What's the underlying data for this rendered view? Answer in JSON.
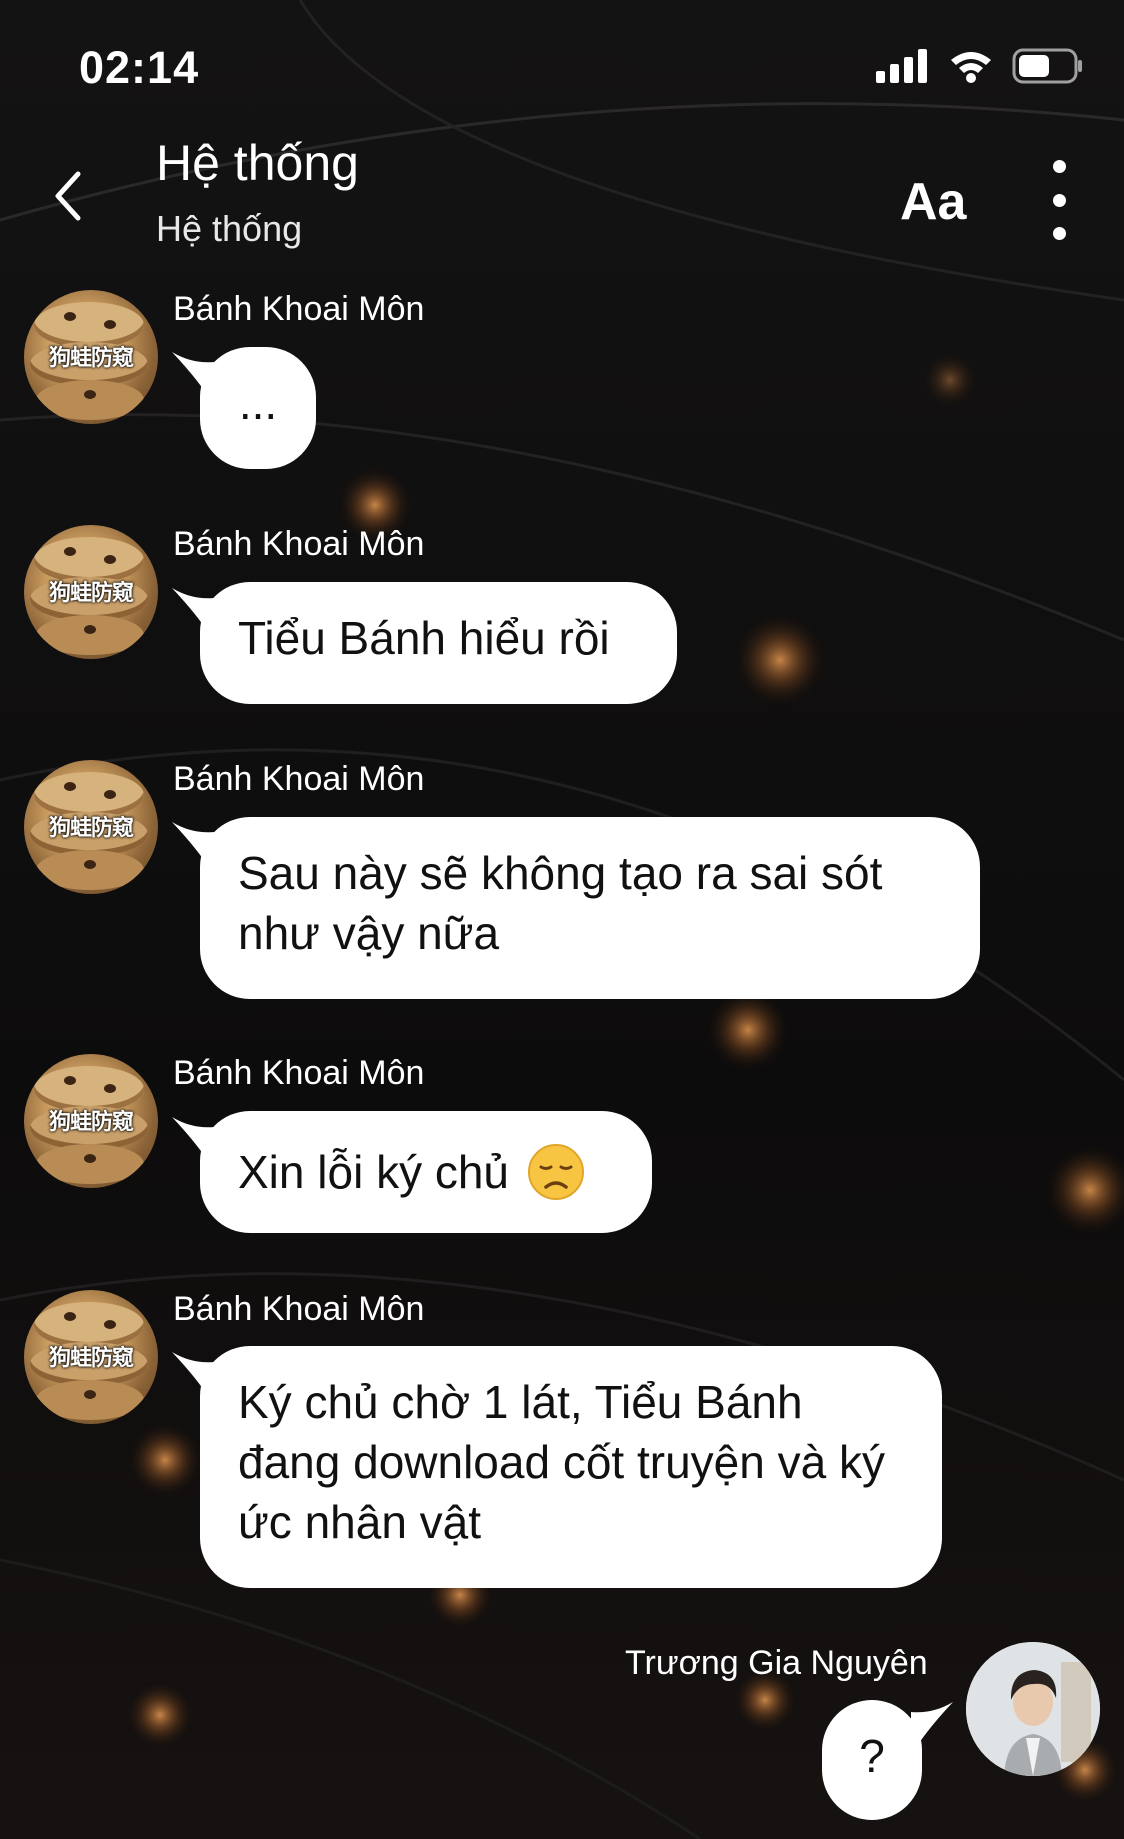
{
  "status_bar": {
    "time": "02:14",
    "icons": [
      "signal-icon",
      "wifi-icon",
      "battery-icon"
    ]
  },
  "header": {
    "back_icon": "chevron-left-icon",
    "title": "Hệ thống",
    "subtitle": "Hệ thống",
    "font_button": "Aa",
    "more_icon": "more-vertical-icon"
  },
  "avatar_watermark": "狗蛙防窥",
  "messages": [
    {
      "sender": "Bánh Khoai Môn",
      "text": "..."
    },
    {
      "sender": "Bánh Khoai Môn",
      "text": "Tiểu Bánh hiểu rồi"
    },
    {
      "sender": "Bánh Khoai Môn",
      "text": "Sau này sẽ không tạo ra sai sót như vậy nữa"
    },
    {
      "sender": "Bánh Khoai Môn",
      "text": "Xin lỗi ký chủ",
      "emoji": "disappointed-face-icon"
    },
    {
      "sender": "Bánh Khoai Môn",
      "text": "Ký chủ chờ 1 lát, Tiểu Bánh đang download cốt truyện và ký ức nhân vật"
    },
    {
      "sender": "Trương Gia Nguyên",
      "text": "?"
    }
  ],
  "colors": {
    "background": "#0d0c0c",
    "bubble": "#ffffff",
    "text_on_dark": "#ffffff",
    "text_on_bubble": "#111111"
  }
}
